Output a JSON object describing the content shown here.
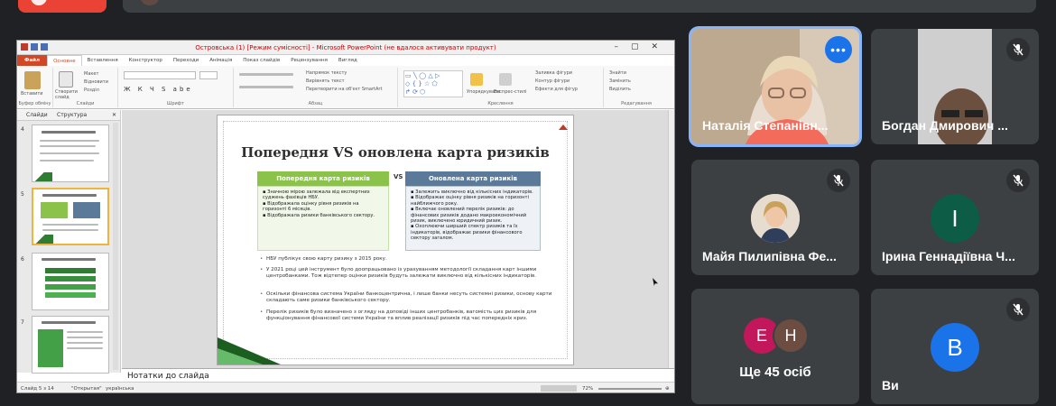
{
  "powerpoint": {
    "title": "Островська (1) [Режим сумісності] - Microsoft PowerPoint (не вдалося активувати продукт)",
    "tabs": [
      "Файл",
      "Основне",
      "Вставлення",
      "Конструктор",
      "Переходи",
      "Анімація",
      "Показ слайдів",
      "Рецензування",
      "Вигляд"
    ],
    "ribbon_groups": [
      "Буфер обміну",
      "Слайди",
      "Шрифт",
      "Абзац",
      "Креслення",
      "Редагування"
    ],
    "ribbon_items": {
      "paste": "Вставити",
      "new_slide": "Створити слайд",
      "layout": "Макет",
      "reset": "Відновити",
      "section": "Розділ",
      "text_direction": "Напрямок тексту",
      "align_text": "Вирівнять текст",
      "smartart": "Перетворити на об'єкт SmartArt",
      "arrange": "Упорядкувати",
      "quick_styles": "Експрес-стилі",
      "shape_fill": "Заливка фігури",
      "shape_outline": "Контур фігури",
      "shape_effects": "Ефекти для фігур",
      "find": "Знайти",
      "replace": "Замінить",
      "select": "Виділить"
    },
    "left_panel": {
      "tab_slides": "Слайди",
      "tab_outline": "Структура",
      "numbers": [
        "4",
        "5",
        "6",
        "7"
      ]
    },
    "notes_placeholder": "Нотатки до слайда",
    "status": {
      "slide": "Слайд 5 з 14",
      "theme": "\"Открытая\"",
      "lang": "українська",
      "zoom": "72%"
    }
  },
  "slide": {
    "title": "Попередня VS оновлена карта ризиків",
    "left_header": "Попередня карта ризиків",
    "right_header": "Оновлена карта ризиків",
    "vs": "VS",
    "left_items": [
      "Значною мірою залежала від експертних суджень фахівців НБУ.",
      "Відображала оцінку рівня ризиків на горизонті 6 місяців.",
      "Відображала ризики банківського сектору."
    ],
    "right_items": [
      "Залежить виключно від кількісних індикаторів.",
      "Відображає оцінку рівня ризиків на горизонті найближчого року.",
      "Включає оновлений перелік ризиків: до фінансових ризиків додано макроекономічний ризик, виключено юридичний ризик.",
      "Охоплюючи ширший спектр ризиків та їх індикаторів, відображає ризики фінансового сектору загалом."
    ],
    "bullets": [
      "НБУ публікує свою карту ризику з 2015 року.",
      "У 2021 році цей інструмент було доопрацьовано із урахуванням методології складання карт іншими центробанками. Тож відтепер оцінки ризиків будуть залежати виключно від кількісних індикаторів.",
      "Оскільки фінансова система України банкоцентрична, і лише банки несуть системні ризики, основу карти складають саме ризики банківського сектору.",
      "Перелік ризиків було визначено з огляду на доповіді інших центробанків, вагомість цих ризиків для функціонування фінансової системи України та вплив реалізації ризиків під час попередніх криз."
    ],
    "colors": {
      "left": "#8bc34a",
      "right": "#5b7a99",
      "title": "#303030"
    }
  },
  "participants": [
    {
      "name": "Наталія Степанівн...",
      "icon": "more-options-icon",
      "more": "•••"
    },
    {
      "name": "Богдан Дмирович ...",
      "icon": "mic-off-icon"
    },
    {
      "name": "Майя Пилипівна Фе...",
      "icon": "mic-off-icon"
    },
    {
      "name": "Ірина Геннадіївна Ч...",
      "icon": "mic-off-icon",
      "initial": "І",
      "color": "#0d5c46"
    },
    {
      "name": "Ще 45 осіб",
      "initials": [
        "Е",
        "Н"
      ],
      "colors": [
        "#c2185b",
        "#6d4c41"
      ]
    },
    {
      "name": "Ви",
      "icon": "mic-off-icon",
      "initial": "В",
      "color": "#1a73e8"
    }
  ]
}
